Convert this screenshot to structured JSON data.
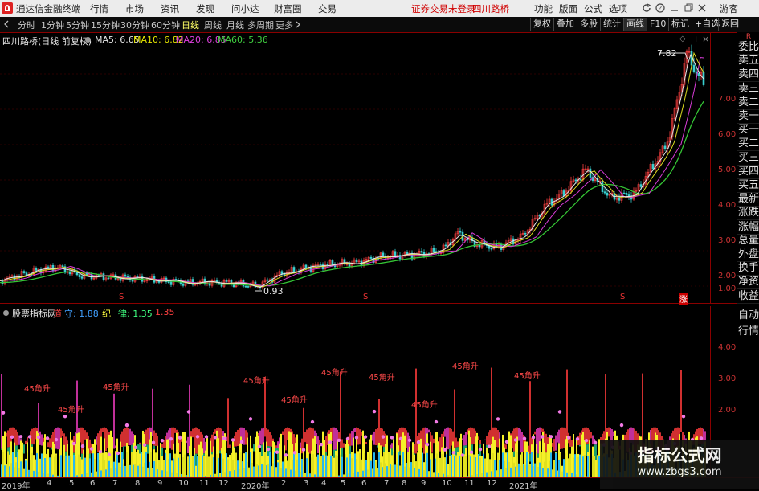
{
  "menubar": {
    "app_title": "通达信金融终端",
    "items": [
      "行情",
      "市场",
      "资讯",
      "发现",
      "问小达",
      "财富圈",
      "交易"
    ],
    "status": "证券交易未登录",
    "stock_name": "四川路桥",
    "right_items": [
      "功能",
      "版面",
      "公式",
      "选项"
    ],
    "guest": "游客"
  },
  "toolbar": {
    "periods": [
      "分时",
      "1分钟",
      "5分钟",
      "15分钟",
      "30分钟",
      "60分钟",
      "日线",
      "周线",
      "月线",
      "多周期",
      "更多"
    ],
    "active_period": "日线",
    "right_buttons": [
      "复权",
      "叠加",
      "多股",
      "统计",
      "画线",
      "F10",
      "标记",
      "+自选",
      "返回"
    ]
  },
  "main_chart": {
    "title": "四川路桥(日线 前复权)",
    "ma": [
      {
        "label": "MA5: 6.65",
        "color": "#e8e8e8"
      },
      {
        "label": "MA10: 6.82",
        "color": "#e8e800"
      },
      {
        "label": "MA20: 6.85",
        "color": "#e040e0"
      },
      {
        "label": "MA60: 5.36",
        "color": "#40d040"
      }
    ],
    "y_ticks": [
      "7.00",
      "6.00",
      "5.00",
      "4.00",
      "3.00",
      "2.00",
      "1.00"
    ],
    "high_label": "7.82",
    "low_label": "0.93",
    "markers": [
      "S",
      "S",
      "S",
      "涨"
    ]
  },
  "sub_chart": {
    "title": "股票指标网",
    "items": [
      {
        "label": "道",
        "color": "#ff4040"
      },
      {
        "label": "守: 1.88",
        "color": "#40a0ff"
      },
      {
        "label": "纪",
        "color": "#ffff40"
      },
      {
        "label": "律: 1.35",
        "color": "#40ff80"
      },
      {
        "label": "1.35",
        "color": "#ff4040"
      }
    ],
    "y_ticks": [
      "4.00",
      "3.00",
      "2.00"
    ],
    "rise_label": "45角升"
  },
  "right_panel": {
    "top_label": "R",
    "items": [
      "委比",
      "卖五",
      "卖四",
      "卖三",
      "卖二",
      "卖一",
      "买一",
      "买二",
      "买三",
      "买四",
      "买五",
      "最新",
      "涨跌",
      "涨幅",
      "总量",
      "外盘",
      "换手",
      "净资",
      "收益"
    ]
  },
  "right_panel2": {
    "items": [
      "自动",
      "行情"
    ]
  },
  "xaxis": {
    "labels": [
      "2019年",
      "4",
      "5",
      "6",
      "7",
      "8",
      "9",
      "10",
      "11",
      "12",
      "2020年",
      "2",
      "3",
      "4",
      "5",
      "6",
      "7",
      "8",
      "9",
      "10",
      "11",
      "12",
      "2021年"
    ]
  },
  "watermark": {
    "line1": "指标公式网",
    "line2": "www.zbgs3.com"
  }
}
